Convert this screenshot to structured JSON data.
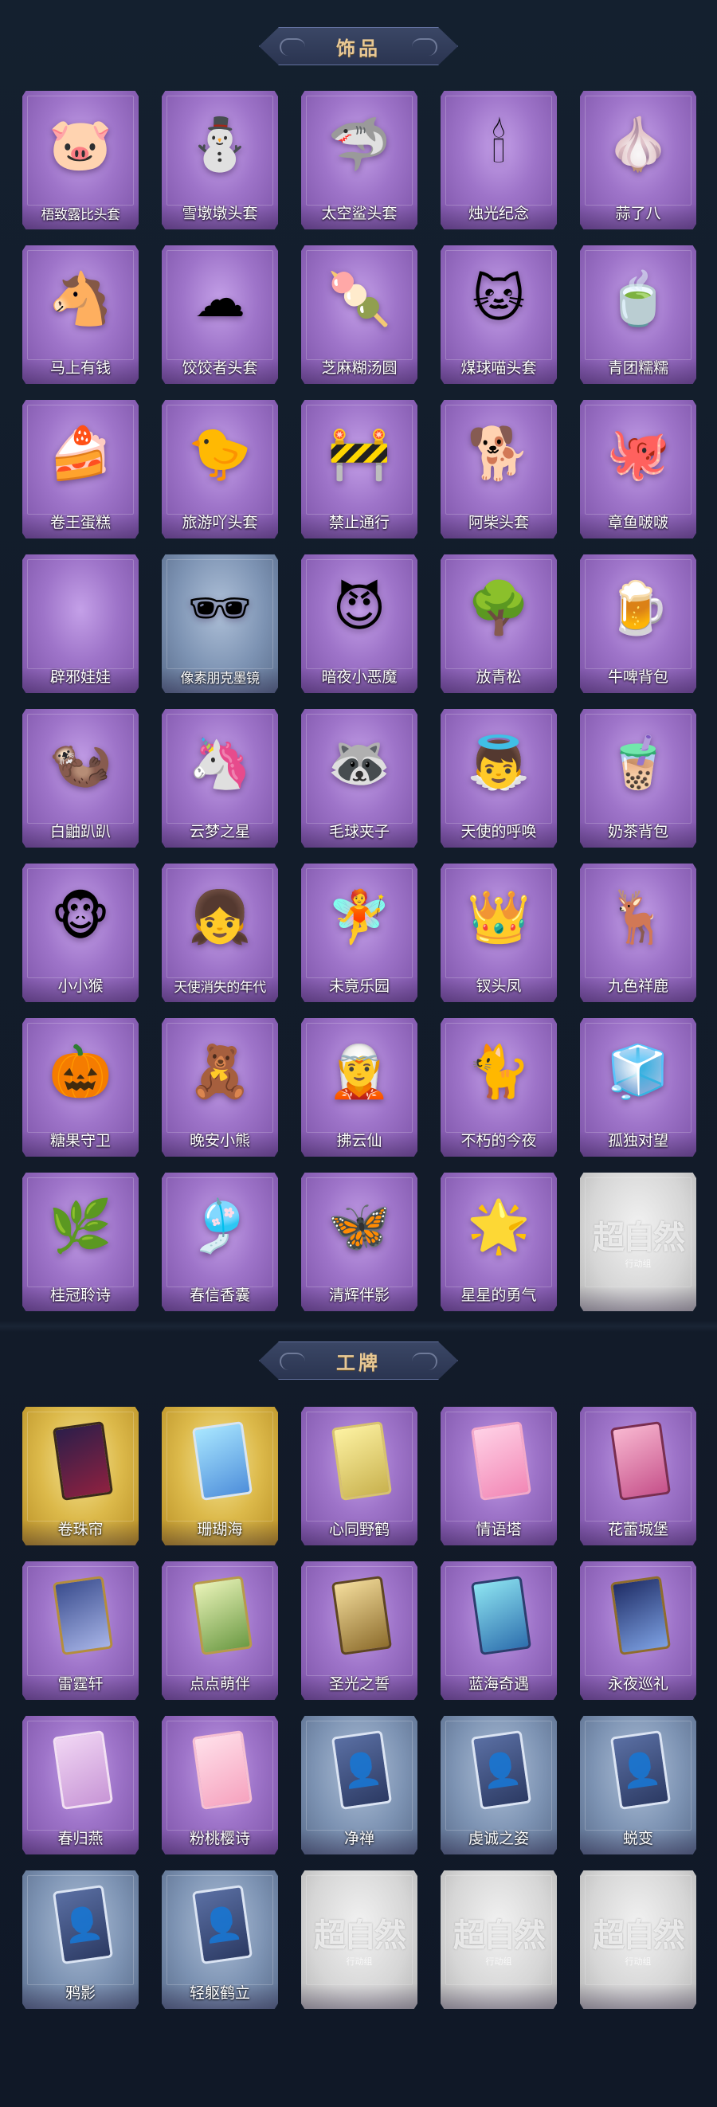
{
  "sections": [
    {
      "title": "饰品",
      "items": [
        {
          "label": "梧致露比头套",
          "icon": "pink-mascot-head",
          "frame": "purple",
          "glyph": "🐷"
        },
        {
          "label": "雪墩墩头套",
          "icon": "snow-deer-hat",
          "frame": "purple",
          "glyph": "⛄"
        },
        {
          "label": "太空鲨头套",
          "icon": "space-shark-head",
          "frame": "purple",
          "glyph": "🦈"
        },
        {
          "label": "烛光纪念",
          "icon": "candle-head",
          "frame": "purple",
          "glyph": "🕯"
        },
        {
          "label": "蒜了八",
          "icon": "garlic-head",
          "frame": "purple",
          "glyph": "🧄"
        },
        {
          "label": "马上有钱",
          "icon": "horse-head",
          "frame": "purple",
          "glyph": "🐴"
        },
        {
          "label": "饺饺者头套",
          "icon": "dumpling-cloud-head",
          "frame": "purple",
          "glyph": "☁"
        },
        {
          "label": "芝麻糊汤圆",
          "icon": "tangyuan-head",
          "frame": "purple",
          "glyph": "🍡"
        },
        {
          "label": "煤球喵头套",
          "icon": "black-cat-head",
          "frame": "purple",
          "glyph": "🐱"
        },
        {
          "label": "青团糯糯",
          "icon": "green-rice-ball-head",
          "frame": "purple",
          "glyph": "🍵"
        },
        {
          "label": "卷王蛋糕",
          "icon": "roll-cake-head",
          "frame": "purple",
          "glyph": "🍰"
        },
        {
          "label": "旅游吖头套",
          "icon": "duck-hat-head",
          "frame": "purple",
          "glyph": "🐤"
        },
        {
          "label": "禁止通行",
          "icon": "traffic-cone-head",
          "frame": "purple",
          "glyph": "🚧"
        },
        {
          "label": "阿柴头套",
          "icon": "shiba-head",
          "frame": "purple",
          "glyph": "🐕"
        },
        {
          "label": "章鱼啵啵",
          "icon": "octopus-head",
          "frame": "purple",
          "glyph": "🐙"
        },
        {
          "label": "辟邪娃娃",
          "icon": "charm-doll",
          "frame": "purple",
          "glyph": ""
        },
        {
          "label": "像素朋克墨镜",
          "icon": "pixel-sunglasses",
          "frame": "steel",
          "glyph": "🕶"
        },
        {
          "label": "暗夜小恶魔",
          "icon": "little-devil",
          "frame": "purple",
          "glyph": "😈"
        },
        {
          "label": "放青松",
          "icon": "pine-bonsai",
          "frame": "purple",
          "glyph": "🌳"
        },
        {
          "label": "牛啤背包",
          "icon": "cow-beer-backpack",
          "frame": "purple",
          "glyph": "🍺"
        },
        {
          "label": "白鼬趴趴",
          "icon": "white-ferret",
          "frame": "purple",
          "glyph": "🦦"
        },
        {
          "label": "云梦之星",
          "icon": "unicorn-cloud",
          "frame": "purple",
          "glyph": "🦄"
        },
        {
          "label": "毛球夹子",
          "icon": "raccoon-clip",
          "frame": "purple",
          "glyph": "🦝"
        },
        {
          "label": "天使的呼唤",
          "icon": "angel-pendant",
          "frame": "purple",
          "glyph": "👼"
        },
        {
          "label": "奶茶背包",
          "icon": "milk-tea-backpack",
          "frame": "purple",
          "glyph": "🧋"
        },
        {
          "label": "小小猴",
          "icon": "little-monkey",
          "frame": "purple",
          "glyph": "🐵"
        },
        {
          "label": "天使消失的年代",
          "icon": "angel-girl-pendant",
          "frame": "purple",
          "glyph": "👧"
        },
        {
          "label": "未竟乐园",
          "icon": "paradise-girl-pendant",
          "frame": "purple",
          "glyph": "🧚"
        },
        {
          "label": "钗头凤",
          "icon": "phoenix-pendant",
          "frame": "purple",
          "glyph": "👑"
        },
        {
          "label": "九色祥鹿",
          "icon": "nine-color-deer",
          "frame": "purple",
          "glyph": "🦌"
        },
        {
          "label": "糖果守卫",
          "icon": "candy-guard",
          "frame": "purple",
          "glyph": "🎃"
        },
        {
          "label": "晚安小熊",
          "icon": "goodnight-bear",
          "frame": "purple",
          "glyph": "🧸"
        },
        {
          "label": "拂云仙",
          "icon": "cloud-fairy",
          "frame": "purple",
          "glyph": "🧝"
        },
        {
          "label": "不朽的今夜",
          "icon": "immortal-night",
          "frame": "purple",
          "glyph": "🐈"
        },
        {
          "label": "孤独对望",
          "icon": "lonely-gaze",
          "frame": "purple",
          "glyph": "🧊"
        },
        {
          "label": "桂冠聆诗",
          "icon": "laurel-poet",
          "frame": "purple",
          "glyph": "🌿"
        },
        {
          "label": "春信香囊",
          "icon": "spring-sachet",
          "frame": "purple",
          "glyph": "🎐"
        },
        {
          "label": "清辉伴影",
          "icon": "moonlight-companion",
          "frame": "purple",
          "glyph": "🦋"
        },
        {
          "label": "星星的勇气",
          "icon": "star-courage",
          "frame": "purple",
          "glyph": "🌟"
        },
        {
          "label": "",
          "icon": "placeholder-logo",
          "frame": "silver",
          "glyph": ""
        }
      ]
    },
    {
      "title": "工牌",
      "items": [
        {
          "label": "卷珠帘",
          "icon": "badge-card",
          "frame": "gold",
          "card": "c-red"
        },
        {
          "label": "珊瑚海",
          "icon": "badge-card",
          "frame": "gold",
          "card": "c-blue"
        },
        {
          "label": "心同野鹤",
          "icon": "badge-card",
          "frame": "purple",
          "card": "c-yellow"
        },
        {
          "label": "情语塔",
          "icon": "badge-card",
          "frame": "purple",
          "card": "c-pink"
        },
        {
          "label": "花蕾城堡",
          "icon": "badge-card",
          "frame": "purple",
          "card": "c-castle"
        },
        {
          "label": "雷霆轩",
          "icon": "badge-card",
          "frame": "purple",
          "card": "c-navy"
        },
        {
          "label": "点点萌伴",
          "icon": "badge-card",
          "frame": "purple",
          "card": "c-field"
        },
        {
          "label": "圣光之誓",
          "icon": "badge-card",
          "frame": "purple",
          "card": "c-gold"
        },
        {
          "label": "蓝海奇遇",
          "icon": "badge-card",
          "frame": "purple",
          "card": "c-sea"
        },
        {
          "label": "永夜巡礼",
          "icon": "badge-card",
          "frame": "purple",
          "card": "c-night"
        },
        {
          "label": "春归燕",
          "icon": "badge-card",
          "frame": "purple",
          "card": "c-lilac"
        },
        {
          "label": "粉桃樱诗",
          "icon": "badge-card",
          "frame": "purple",
          "card": "c-sakura"
        },
        {
          "label": "净禅",
          "icon": "badge-silhouette",
          "frame": "steel",
          "card": "c-silhouette"
        },
        {
          "label": "虔诚之姿",
          "icon": "badge-silhouette",
          "frame": "steel",
          "card": "c-silhouette"
        },
        {
          "label": "蜕变",
          "icon": "badge-silhouette",
          "frame": "steel",
          "card": "c-silhouette"
        },
        {
          "label": "鸦影",
          "icon": "badge-silhouette",
          "frame": "steel",
          "card": "c-silhouette"
        },
        {
          "label": "轻躯鹤立",
          "icon": "badge-silhouette",
          "frame": "steel",
          "card": "c-silhouette"
        },
        {
          "label": "",
          "icon": "placeholder-logo",
          "frame": "silver",
          "card": ""
        },
        {
          "label": "",
          "icon": "placeholder-logo",
          "frame": "silver",
          "card": ""
        },
        {
          "label": "",
          "icon": "placeholder-logo",
          "frame": "silver",
          "card": ""
        }
      ]
    }
  ],
  "placeholder": {
    "logo_text": "超自然",
    "sub_text": "行动组"
  }
}
